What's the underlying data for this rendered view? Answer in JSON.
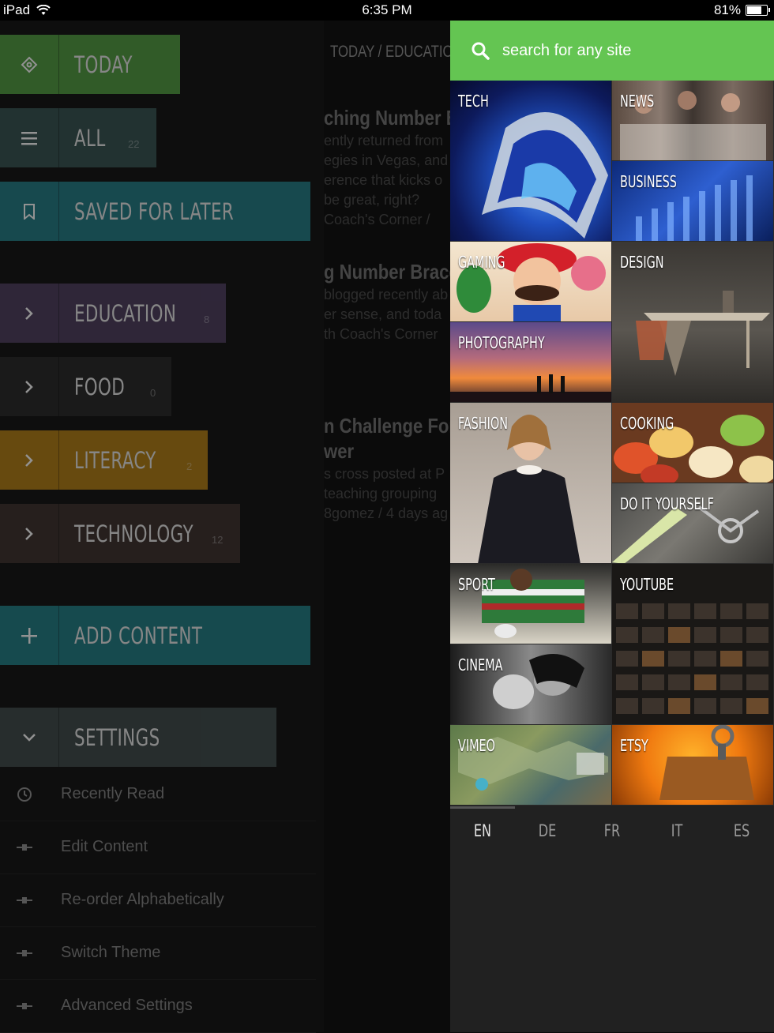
{
  "status_bar": {
    "device": "iPad",
    "time": "6:35 PM",
    "battery": "81%",
    "battery_level": 0.81
  },
  "nav": [
    {
      "label": "Today",
      "count": "",
      "color": "#4f9a3f",
      "icon": "tag-icon"
    },
    {
      "label": "All",
      "count": "22",
      "color": "#33514f",
      "icon": "menu-icon"
    },
    {
      "label": "Saved for later",
      "count": "",
      "color": "#1f7a84",
      "icon": "bookmark-icon"
    },
    {
      "label": "Education",
      "count": "8",
      "color": "#4a3b5c",
      "icon": "chevron-right-icon"
    },
    {
      "label": "Food",
      "count": "0",
      "color": "#242424",
      "icon": "chevron-right-icon"
    },
    {
      "label": "Literacy",
      "count": "2",
      "color": "#b07b10",
      "icon": "chevron-right-icon"
    },
    {
      "label": "Technology",
      "count": "12",
      "color": "#3a2d2b",
      "icon": "chevron-right-icon"
    },
    {
      "label": "Add content",
      "count": "",
      "color": "#1d7b84",
      "icon": "plus-icon"
    },
    {
      "label": "Settings",
      "count": "",
      "color": "#3d4848",
      "icon": "chevron-down-icon"
    }
  ],
  "settings_items": [
    {
      "label": "Recently Read",
      "icon": "clock-icon"
    },
    {
      "label": "Edit Content",
      "icon": "slider-icon"
    },
    {
      "label": "Re-order Alphabetically",
      "icon": "slider-icon"
    },
    {
      "label": "Switch Theme",
      "icon": "slider-icon"
    },
    {
      "label": "Advanced Settings",
      "icon": "slider-icon"
    }
  ],
  "article_peek": {
    "breadcrumb": "TODAY / EDUCATION",
    "items": [
      {
        "title": "ching Number Bo",
        "lines": [
          "ently returned from",
          "egies in Vegas, and",
          "erence that kicks o",
          "be great, right?",
          "Coach's Corner /"
        ]
      },
      {
        "title": "g Number Brace",
        "lines": [
          "blogged recently ab",
          "er sense, and toda",
          "th Coach's Corner"
        ]
      },
      {
        "title": "n Challenge For",
        "title2": "wer",
        "lines": [
          "s cross posted at P",
          "teaching grouping",
          "8gomez / 4 days ag"
        ]
      }
    ]
  },
  "search": {
    "placeholder": "search for any site"
  },
  "categories": [
    {
      "label": "Tech"
    },
    {
      "label": "News"
    },
    {
      "label": "Business"
    },
    {
      "label": "Gaming"
    },
    {
      "label": "Design"
    },
    {
      "label": "Photography"
    },
    {
      "label": "Fashion"
    },
    {
      "label": "Cooking"
    },
    {
      "label": "Do it yourself"
    },
    {
      "label": "Sport"
    },
    {
      "label": "YouTube"
    },
    {
      "label": "Cinema"
    },
    {
      "label": "Vimeo"
    },
    {
      "label": "Etsy"
    }
  ],
  "languages": [
    {
      "code": "EN",
      "active": true
    },
    {
      "code": "DE",
      "active": false
    },
    {
      "code": "FR",
      "active": false
    },
    {
      "code": "IT",
      "active": false
    },
    {
      "code": "ES",
      "active": false
    }
  ]
}
